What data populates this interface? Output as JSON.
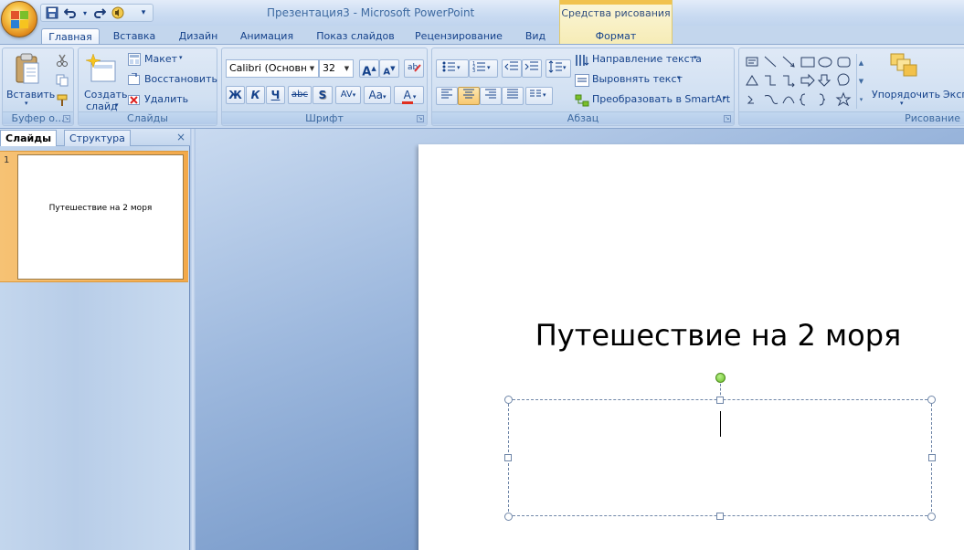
{
  "window": {
    "title": "Презентация3 - Microsoft PowerPoint",
    "context_group": "Средства рисования"
  },
  "tabs": [
    {
      "label": "Главная",
      "active": true
    },
    {
      "label": "Вставка"
    },
    {
      "label": "Дизайн"
    },
    {
      "label": "Анимация"
    },
    {
      "label": "Показ слайдов"
    },
    {
      "label": "Рецензирование"
    },
    {
      "label": "Вид"
    },
    {
      "label": "Формат"
    }
  ],
  "ribbon": {
    "clipboard": {
      "label": "Буфер о...",
      "paste": "Вставить"
    },
    "slides": {
      "label": "Слайды",
      "new_slide_line1": "Создать",
      "new_slide_line2": "слайд",
      "layout": "Макет",
      "reset": "Восстановить",
      "delete": "Удалить"
    },
    "font": {
      "label": "Шрифт",
      "font_name": "Calibri (Основно",
      "font_size": "32",
      "bold": "Ж",
      "italic": "К",
      "underline": "Ч",
      "strike": "abc",
      "shadow": "S",
      "spacing": "AV",
      "change_case": "Aa",
      "color": "A",
      "grow": "A",
      "shrink": "A"
    },
    "paragraph": {
      "label": "Абзац",
      "text_direction": "Направление текста",
      "align_text": "Выровнять текст",
      "smartart": "Преобразовать в SmartArt"
    },
    "drawing": {
      "label": "Рисование",
      "arrange": "Упорядочить",
      "quick_styles": "Эксп"
    }
  },
  "pane": {
    "tab_slides": "Слайды",
    "tab_outline": "Структура",
    "close": "×",
    "slide_number": "1",
    "thumb_title": "Путешествие на 2 моря"
  },
  "slide": {
    "title": "Путешествие на 2 моря"
  },
  "colors": {
    "accent_orange": "#f3a94a",
    "ribbon_blue": "#d3e1f3",
    "context_yellow": "#f6ecb6"
  }
}
